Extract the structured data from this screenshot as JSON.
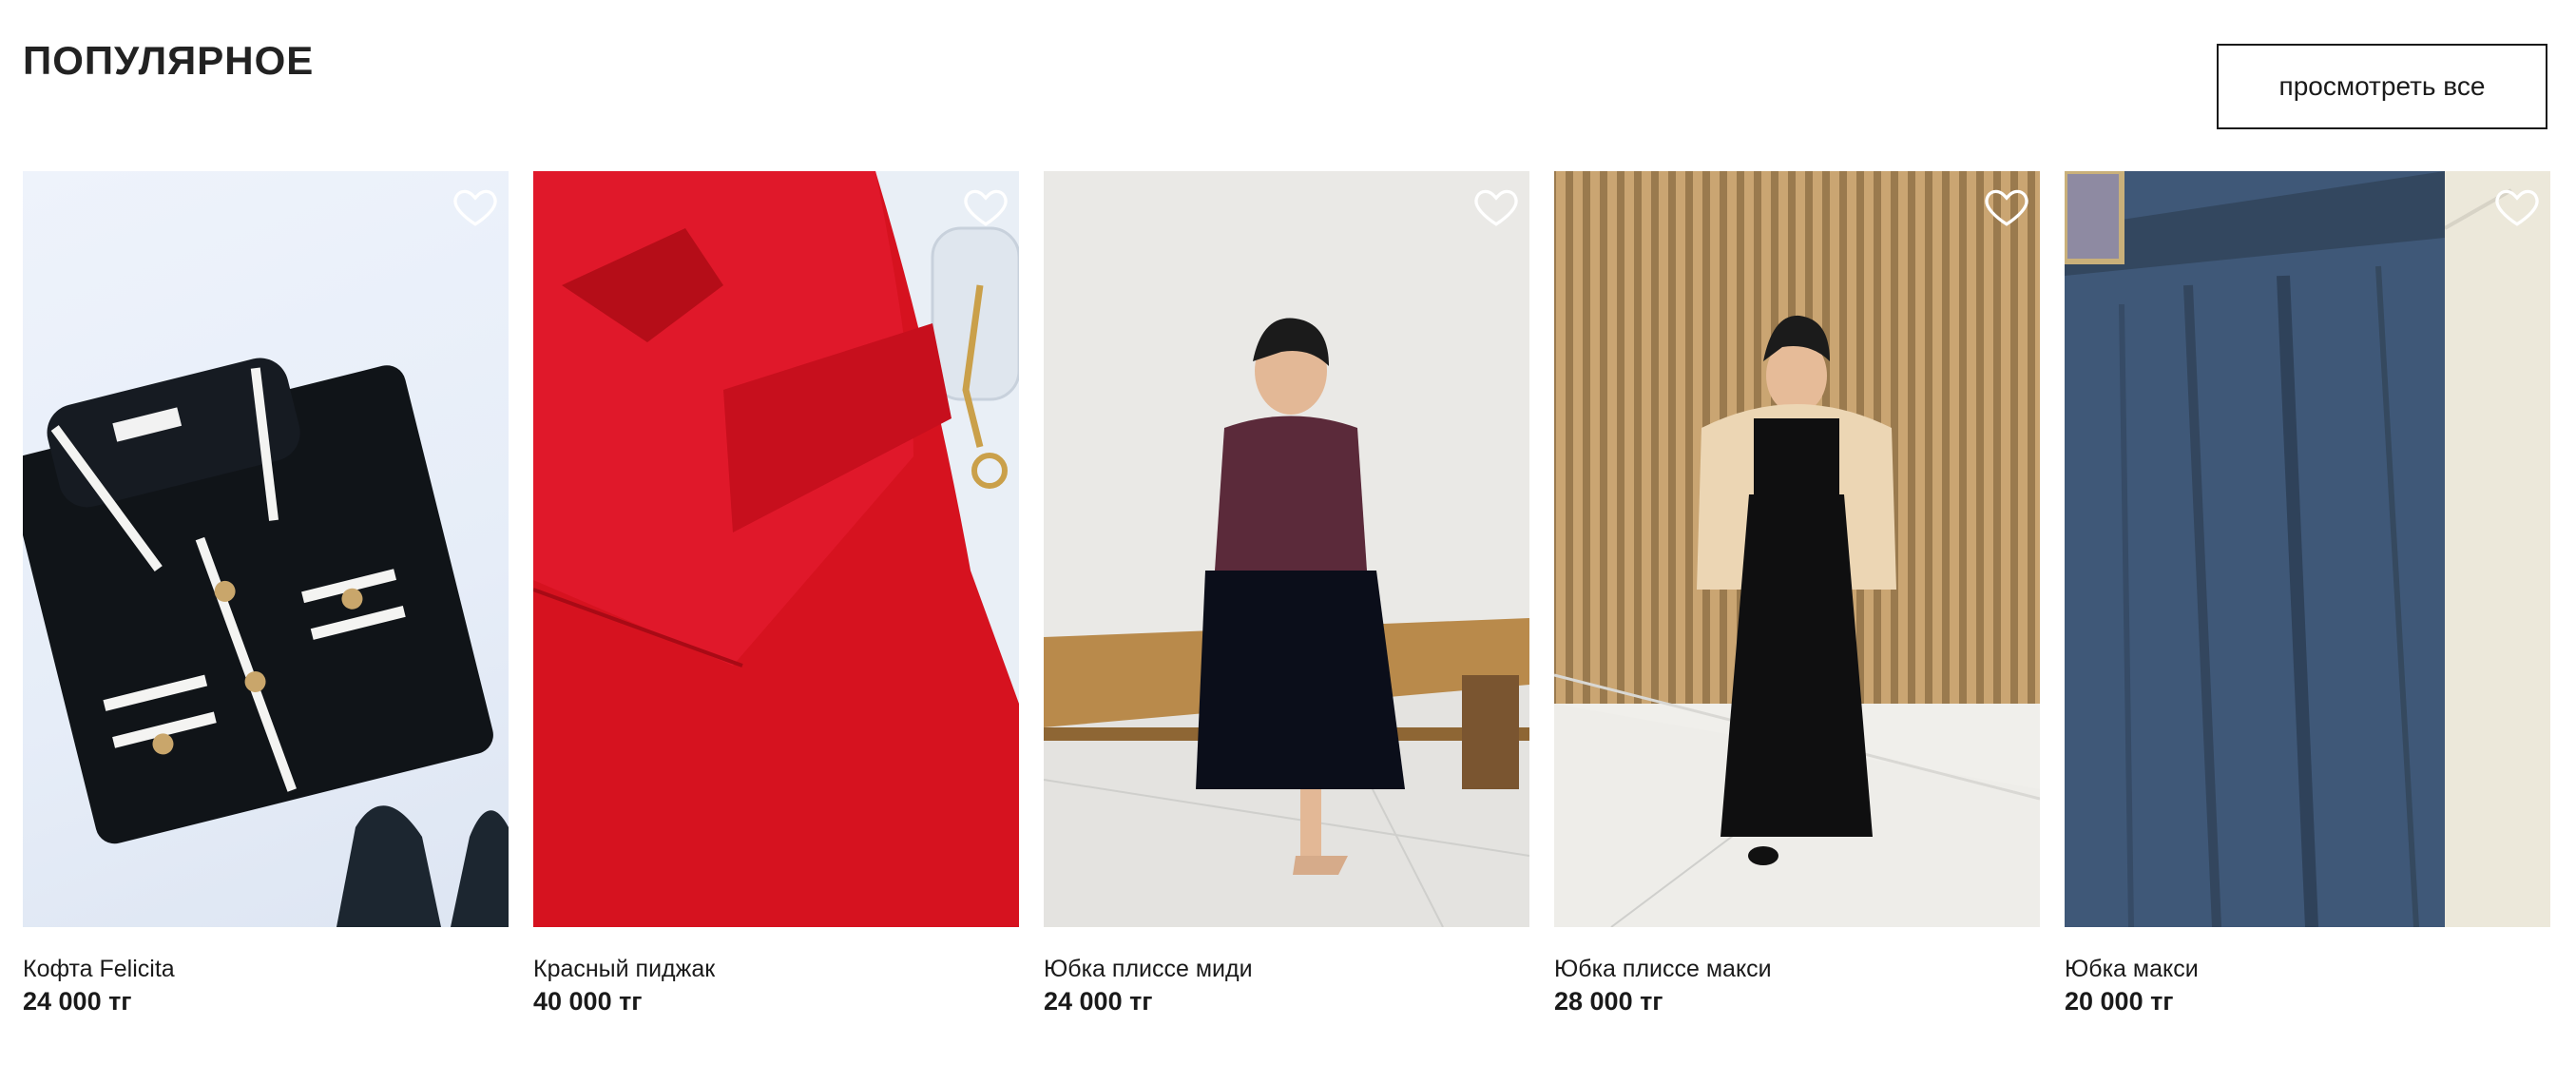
{
  "section": {
    "title": "ПОПУЛЯРНОЕ",
    "view_all_label": "просмотреть все"
  },
  "products": [
    {
      "name": "Кофта Felicita",
      "price": "24 000 тг",
      "favorite_icon": "heart-outline-icon"
    },
    {
      "name": "Красный пиджак",
      "price": "40 000 тг",
      "favorite_icon": "heart-outline-icon"
    },
    {
      "name": "Юбка плиссе миди",
      "price": "24 000 тг",
      "favorite_icon": "heart-outline-icon"
    },
    {
      "name": "Юбка плиссе макси",
      "price": "28 000 тг",
      "favorite_icon": "heart-outline-icon"
    },
    {
      "name": "Юбка макси",
      "price": "20 000 тг",
      "favorite_icon": "heart-outline-icon"
    }
  ],
  "colors": {
    "text": "#1a1a1a",
    "background": "#ffffff",
    "button_border": "#1a1a1a"
  }
}
